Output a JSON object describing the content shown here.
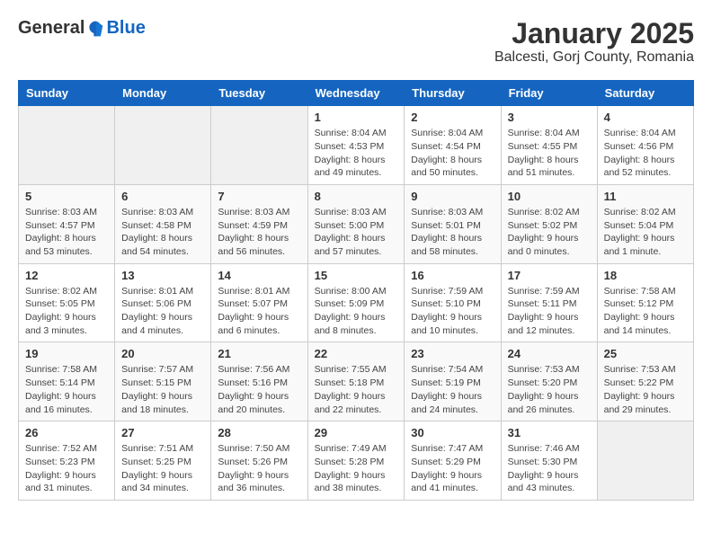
{
  "header": {
    "logo_general": "General",
    "logo_blue": "Blue",
    "title": "January 2025",
    "subtitle": "Balcesti, Gorj County, Romania"
  },
  "weekdays": [
    "Sunday",
    "Monday",
    "Tuesday",
    "Wednesday",
    "Thursday",
    "Friday",
    "Saturday"
  ],
  "weeks": [
    [
      {
        "day": "",
        "info": ""
      },
      {
        "day": "",
        "info": ""
      },
      {
        "day": "",
        "info": ""
      },
      {
        "day": "1",
        "info": "Sunrise: 8:04 AM\nSunset: 4:53 PM\nDaylight: 8 hours\nand 49 minutes."
      },
      {
        "day": "2",
        "info": "Sunrise: 8:04 AM\nSunset: 4:54 PM\nDaylight: 8 hours\nand 50 minutes."
      },
      {
        "day": "3",
        "info": "Sunrise: 8:04 AM\nSunset: 4:55 PM\nDaylight: 8 hours\nand 51 minutes."
      },
      {
        "day": "4",
        "info": "Sunrise: 8:04 AM\nSunset: 4:56 PM\nDaylight: 8 hours\nand 52 minutes."
      }
    ],
    [
      {
        "day": "5",
        "info": "Sunrise: 8:03 AM\nSunset: 4:57 PM\nDaylight: 8 hours\nand 53 minutes."
      },
      {
        "day": "6",
        "info": "Sunrise: 8:03 AM\nSunset: 4:58 PM\nDaylight: 8 hours\nand 54 minutes."
      },
      {
        "day": "7",
        "info": "Sunrise: 8:03 AM\nSunset: 4:59 PM\nDaylight: 8 hours\nand 56 minutes."
      },
      {
        "day": "8",
        "info": "Sunrise: 8:03 AM\nSunset: 5:00 PM\nDaylight: 8 hours\nand 57 minutes."
      },
      {
        "day": "9",
        "info": "Sunrise: 8:03 AM\nSunset: 5:01 PM\nDaylight: 8 hours\nand 58 minutes."
      },
      {
        "day": "10",
        "info": "Sunrise: 8:02 AM\nSunset: 5:02 PM\nDaylight: 9 hours\nand 0 minutes."
      },
      {
        "day": "11",
        "info": "Sunrise: 8:02 AM\nSunset: 5:04 PM\nDaylight: 9 hours\nand 1 minute."
      }
    ],
    [
      {
        "day": "12",
        "info": "Sunrise: 8:02 AM\nSunset: 5:05 PM\nDaylight: 9 hours\nand 3 minutes."
      },
      {
        "day": "13",
        "info": "Sunrise: 8:01 AM\nSunset: 5:06 PM\nDaylight: 9 hours\nand 4 minutes."
      },
      {
        "day": "14",
        "info": "Sunrise: 8:01 AM\nSunset: 5:07 PM\nDaylight: 9 hours\nand 6 minutes."
      },
      {
        "day": "15",
        "info": "Sunrise: 8:00 AM\nSunset: 5:09 PM\nDaylight: 9 hours\nand 8 minutes."
      },
      {
        "day": "16",
        "info": "Sunrise: 7:59 AM\nSunset: 5:10 PM\nDaylight: 9 hours\nand 10 minutes."
      },
      {
        "day": "17",
        "info": "Sunrise: 7:59 AM\nSunset: 5:11 PM\nDaylight: 9 hours\nand 12 minutes."
      },
      {
        "day": "18",
        "info": "Sunrise: 7:58 AM\nSunset: 5:12 PM\nDaylight: 9 hours\nand 14 minutes."
      }
    ],
    [
      {
        "day": "19",
        "info": "Sunrise: 7:58 AM\nSunset: 5:14 PM\nDaylight: 9 hours\nand 16 minutes."
      },
      {
        "day": "20",
        "info": "Sunrise: 7:57 AM\nSunset: 5:15 PM\nDaylight: 9 hours\nand 18 minutes."
      },
      {
        "day": "21",
        "info": "Sunrise: 7:56 AM\nSunset: 5:16 PM\nDaylight: 9 hours\nand 20 minutes."
      },
      {
        "day": "22",
        "info": "Sunrise: 7:55 AM\nSunset: 5:18 PM\nDaylight: 9 hours\nand 22 minutes."
      },
      {
        "day": "23",
        "info": "Sunrise: 7:54 AM\nSunset: 5:19 PM\nDaylight: 9 hours\nand 24 minutes."
      },
      {
        "day": "24",
        "info": "Sunrise: 7:53 AM\nSunset: 5:20 PM\nDaylight: 9 hours\nand 26 minutes."
      },
      {
        "day": "25",
        "info": "Sunrise: 7:53 AM\nSunset: 5:22 PM\nDaylight: 9 hours\nand 29 minutes."
      }
    ],
    [
      {
        "day": "26",
        "info": "Sunrise: 7:52 AM\nSunset: 5:23 PM\nDaylight: 9 hours\nand 31 minutes."
      },
      {
        "day": "27",
        "info": "Sunrise: 7:51 AM\nSunset: 5:25 PM\nDaylight: 9 hours\nand 34 minutes."
      },
      {
        "day": "28",
        "info": "Sunrise: 7:50 AM\nSunset: 5:26 PM\nDaylight: 9 hours\nand 36 minutes."
      },
      {
        "day": "29",
        "info": "Sunrise: 7:49 AM\nSunset: 5:28 PM\nDaylight: 9 hours\nand 38 minutes."
      },
      {
        "day": "30",
        "info": "Sunrise: 7:47 AM\nSunset: 5:29 PM\nDaylight: 9 hours\nand 41 minutes."
      },
      {
        "day": "31",
        "info": "Sunrise: 7:46 AM\nSunset: 5:30 PM\nDaylight: 9 hours\nand 43 minutes."
      },
      {
        "day": "",
        "info": ""
      }
    ]
  ]
}
